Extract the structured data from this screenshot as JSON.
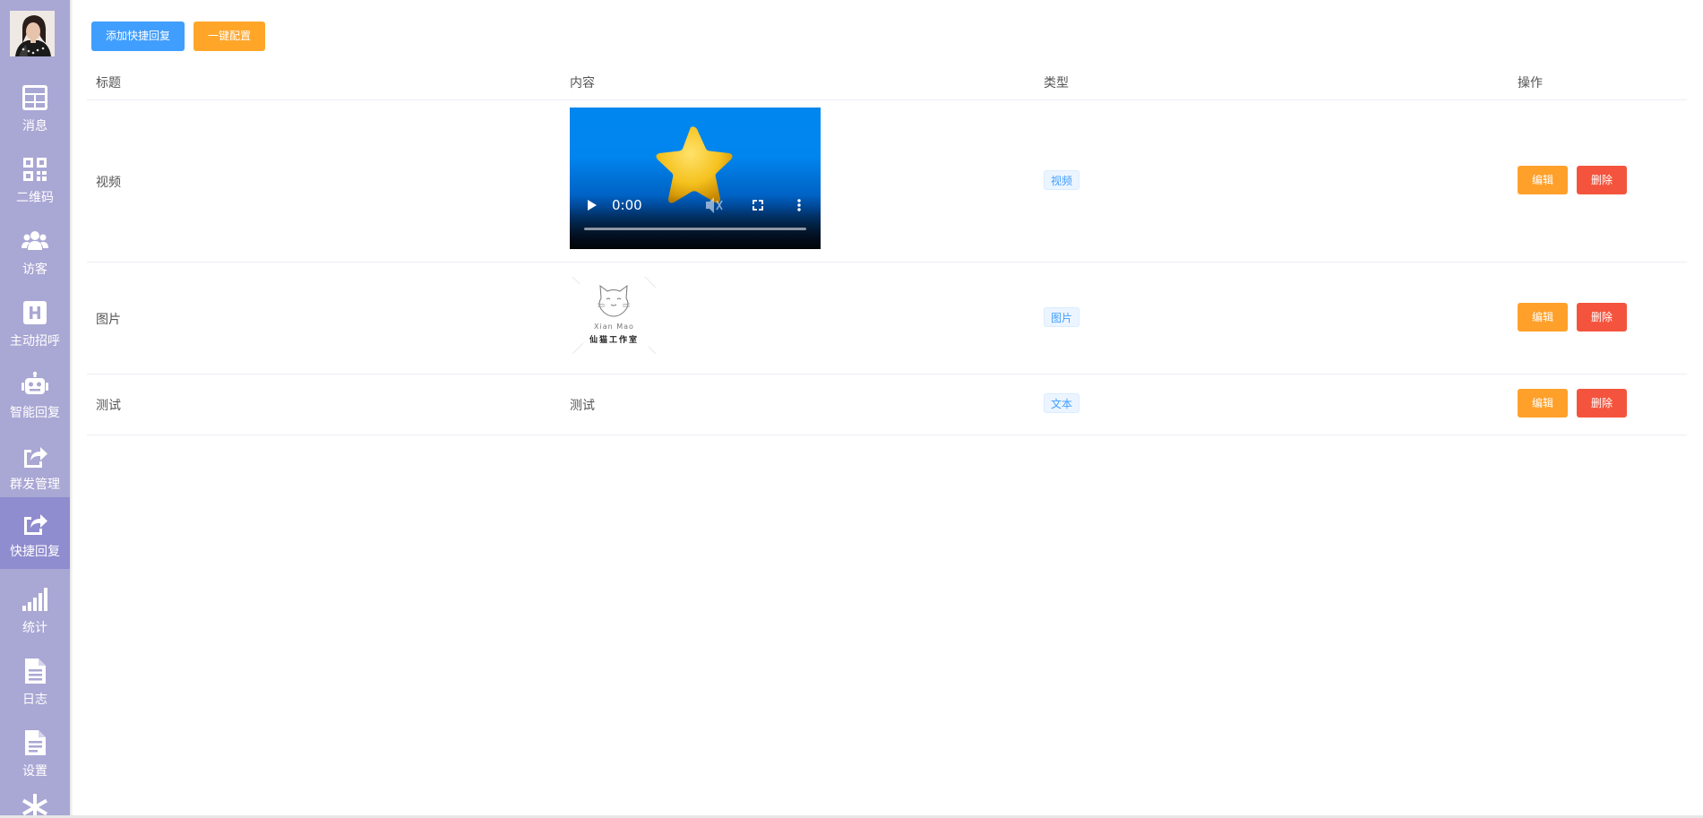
{
  "sidebar": {
    "items": [
      {
        "label": "消息",
        "icon": "dashboard-grid-icon"
      },
      {
        "label": "二维码",
        "icon": "qrcode-icon"
      },
      {
        "label": "访客",
        "icon": "users-icon"
      },
      {
        "label": "主动招呼",
        "icon": "h-square-icon"
      },
      {
        "label": "智能回复",
        "icon": "robot-icon"
      },
      {
        "label": "群发管理",
        "icon": "share-square-icon"
      },
      {
        "label": "快捷回复",
        "icon": "share-square-icon",
        "active": true
      },
      {
        "label": "统计",
        "icon": "signal-bars-icon"
      },
      {
        "label": "日志",
        "icon": "file-text-icon"
      },
      {
        "label": "设置",
        "icon": "file-settings-icon"
      }
    ]
  },
  "toolbar": {
    "add_label": "添加快捷回复",
    "reset_label": "一键配置"
  },
  "table": {
    "columns": [
      "标题",
      "内容",
      "类型",
      "操作"
    ],
    "rows": [
      {
        "title": "视频",
        "content_type": "video",
        "video_time": "0:00",
        "tag": "视频",
        "edit": "编辑",
        "delete": "删除"
      },
      {
        "title": "图片",
        "content_type": "image",
        "image_text_top": "Xian   Mao",
        "image_text_bottom": "仙猫工作室",
        "tag": "图片",
        "edit": "编辑",
        "delete": "删除"
      },
      {
        "title": "测试",
        "content_type": "text",
        "content": "测试",
        "tag": "文本",
        "edit": "编辑",
        "delete": "删除"
      }
    ]
  },
  "colors": {
    "sidebar_bg": "#a9a7d4",
    "sidebar_active": "#8f8ccf",
    "primary": "#409eff",
    "warning": "#ffa629",
    "danger": "#f4543d"
  }
}
